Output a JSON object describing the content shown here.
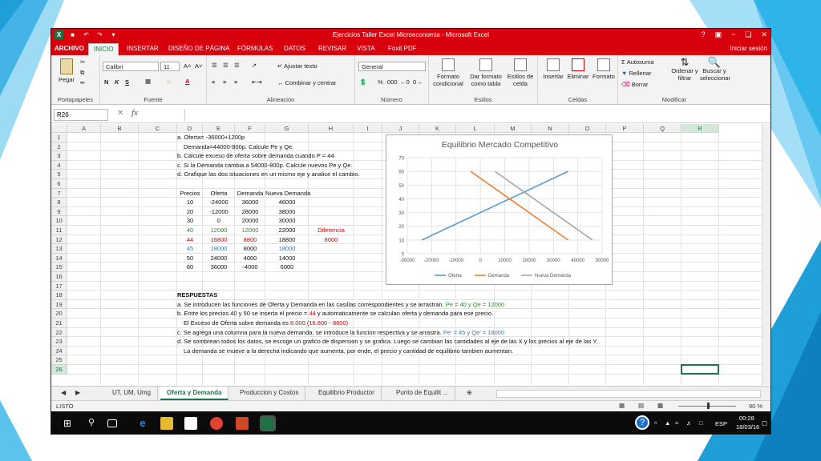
{
  "window": {
    "title": "Ejercicios Taller Excel Microeconomia - Microsoft Excel",
    "help": "?",
    "controls": [
      "−",
      "❏",
      "✕"
    ]
  },
  "tabs": {
    "file": "ARCHIVO",
    "items": [
      "INICIO",
      "INSERTAR",
      "DISEÑO DE PÁGINA",
      "FÓRMULAS",
      "DATOS",
      "REVISAR",
      "VISTA",
      "Foxit PDF"
    ],
    "signin": "Iniciar sesión"
  },
  "ribbon": {
    "clipboard": {
      "paste": "Pegar",
      "label": "Portapapeles"
    },
    "font": {
      "name": "Calibri",
      "size": "11",
      "bold": "N",
      "italic": "K",
      "underline": "S",
      "grow": "A˄",
      "shrink": "A˅",
      "label": "Fuente"
    },
    "alignment": {
      "wrap": "Ajustar texto",
      "merge": "Combinar y centrar",
      "label": "Alineación"
    },
    "number": {
      "format": "General",
      "percent": "%",
      "thousands": "000",
      "inc": "⁰₀ °₀",
      "dec": "°₀",
      "label": "Número"
    },
    "styles": {
      "conditional": "Formato condicional",
      "table": "Dar formato como tabla",
      "cell": "Estilos de celda",
      "label": "Estilos"
    },
    "cells": {
      "insert": "Insertar",
      "delete": "Eliminar",
      "format": "Formato",
      "label": "Celdas"
    },
    "editing": {
      "autosum": "Autosuma",
      "fill": "Rellenar",
      "clear": "Borrar",
      "sort": "Ordenar y filtrar",
      "find": "Buscar y seleccionar",
      "label": "Modificar"
    }
  },
  "formula_bar": {
    "name_box": "R26",
    "fx": "fx",
    "content": ""
  },
  "columns": [
    "A",
    "B",
    "C",
    "D",
    "E",
    "F",
    "G",
    "H",
    "I",
    "J",
    "K",
    "L",
    "M",
    "N",
    "O",
    "P",
    "Q",
    "R"
  ],
  "rows": [
    "1",
    "2",
    "3",
    "4",
    "5",
    "6",
    "7",
    "8",
    "9",
    "10",
    "11",
    "12",
    "13",
    "14",
    "15",
    "16",
    "17",
    "18",
    "19",
    "20",
    "21",
    "22",
    "23",
    "24",
    "25",
    "26"
  ],
  "selected": {
    "col": "R",
    "row": "26"
  },
  "instructions": [
    "a. Oferta= -36000+1200p",
    "Demanda=44000-800p. Calcule Pe y Qe.",
    "b. Calcule exceso de oferta sobre demanda cuando P = 44",
    "c. Si la Demanda cambia a 54000-800p. Calcule nuevos Pe y Qe.",
    "d. Grafique las dos situaciones en un mismo eje y analice el cambio."
  ],
  "table": {
    "headers": [
      "Precios",
      "Oferta",
      "Demanda",
      "Nueva Demanda"
    ],
    "rows": [
      [
        "10",
        "-24000",
        "36000",
        "46000"
      ],
      [
        "20",
        "-12000",
        "28000",
        "38000"
      ],
      [
        "30",
        "0",
        "20000",
        "30000"
      ],
      [
        "40",
        "12000",
        "12000",
        "22000"
      ],
      [
        "44",
        "16800",
        "8800",
        "18800"
      ],
      [
        "45",
        "18000",
        "8000",
        "18000"
      ],
      [
        "50",
        "24000",
        "4000",
        "14000"
      ],
      [
        "60",
        "36000",
        "-4000",
        "6000"
      ]
    ],
    "diff_label": "Diferencia",
    "diff_value": "8000"
  },
  "respuestas": {
    "title": "RESPUESTAS",
    "lines": [
      {
        "text": "a. Se introducen las funciones de Oferta y Demanda en las casillas correspondientes y se arrastran. ",
        "hl": "Pe = 40 y Qe = 12000",
        "hlcolor": "#2e8b2e"
      },
      {
        "text": "b. Entre los precios 40 y 50 se inserta el precio = ",
        "hl": "44",
        "hlcolor": "#d40000",
        "tail": " y automaticamente se calculan oferta y demanda para ese precio."
      },
      {
        "text": "El Exceso de Oferta sobre demanda es ",
        "hl": "8.000 (16.800 - 8800)",
        "hlcolor": "#d40000"
      },
      {
        "text": "c. Se agrega una columna para la nueva demanda, se introduce la funcion respectiva y se arrastra. ",
        "hl": "Pe' = 45 y Qe' = 18000",
        "hlcolor": "#3b73b9"
      },
      {
        "text": "d. Se sombrean todos los datos, se escoge un grafico de dispersion y se grafica. Luego se cambian las cantidades al eje de las X y los precios al eje de las Y."
      },
      {
        "text": "La demanda se mueve a la derecha indicando que aumenta, por ende, el precio y cantidad de equilibrio tambien aumentan."
      }
    ]
  },
  "chart_data": {
    "type": "line",
    "title": "Equilibrio Mercado Competitivo",
    "xlim": [
      -30000,
      50000
    ],
    "ylim": [
      0,
      70
    ],
    "xticks": [
      "-30000",
      "-20000",
      "-10000",
      "0",
      "10000",
      "20000",
      "30000",
      "40000",
      "50000"
    ],
    "yticks": [
      "0",
      "10",
      "20",
      "30",
      "40",
      "50",
      "60",
      "70"
    ],
    "grid": true,
    "legend": "bottom",
    "series": [
      {
        "name": "Oferta",
        "color": "#5b9bd5",
        "points": [
          [
            -24000,
            10
          ],
          [
            36000,
            60
          ]
        ]
      },
      {
        "name": "Demanda",
        "color": "#ed7d31",
        "points": [
          [
            36000,
            10
          ],
          [
            -4000,
            60
          ]
        ]
      },
      {
        "name": "Nueva Demanda",
        "color": "#a5a5a5",
        "points": [
          [
            46000,
            10
          ],
          [
            6000,
            60
          ]
        ]
      }
    ]
  },
  "sheets": {
    "items": [
      "UT, UM, Umg",
      "Oferta y Demanda",
      "Produccion y Costos",
      "Equilibrio Productor",
      "Punto de Equilit ..."
    ],
    "active": 1
  },
  "status": {
    "ready": "LISTO",
    "zoom": "90 %"
  },
  "taskbar": {
    "lang": "ESP",
    "time": "00:28",
    "date": "18/03/16"
  }
}
